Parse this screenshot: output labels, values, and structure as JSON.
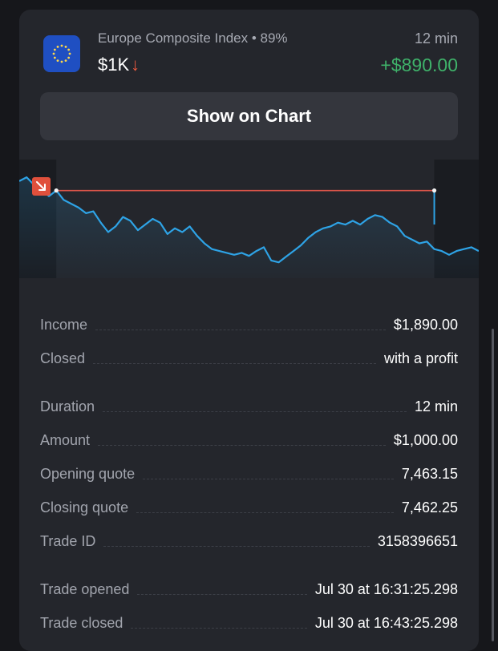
{
  "trade": {
    "asset_name": "Europe Composite Index",
    "separator": " • ",
    "payout_pct": "89%",
    "duration_short": "12 min",
    "amount": "$1K",
    "direction_icon": "arrow-down-icon",
    "direction_glyph": "↓",
    "profit": "+$890.00"
  },
  "buttons": {
    "show_on_chart": "Show on Chart"
  },
  "details": {
    "income": {
      "label": "Income",
      "value": "$1,890.00"
    },
    "closed": {
      "label": "Closed",
      "value": "with a profit"
    },
    "duration": {
      "label": "Duration",
      "value": "12 min"
    },
    "amount": {
      "label": "Amount",
      "value": "$1,000.00"
    },
    "opening_quote": {
      "label": "Opening quote",
      "value": "7,463.15"
    },
    "closing_quote": {
      "label": "Closing quote",
      "value": "7,462.25"
    },
    "trade_id": {
      "label": "Trade ID",
      "value": "3158396651"
    },
    "trade_opened": {
      "label": "Trade opened",
      "value": "Jul 30 at 16:31:25.298"
    },
    "trade_closed": {
      "label": "Trade closed",
      "value": "Jul 30 at 16:43:25.298"
    }
  },
  "colors": {
    "price_line": "#2ea3e6",
    "level_line": "#e0564a",
    "profit": "#3fb26a",
    "down_arrow": "#ef5a3f",
    "flag_blue": "#1f4fc2"
  },
  "chart_data": {
    "type": "line",
    "series": [
      {
        "values": [
          7463.4,
          7463.5,
          7463.3,
          7463.2,
          7463.0,
          7463.15,
          7462.9,
          7462.8,
          7462.7,
          7462.55,
          7462.6,
          7462.3,
          7462.05,
          7462.2,
          7462.45,
          7462.35,
          7462.1,
          7462.25,
          7462.4,
          7462.3,
          7462.0,
          7462.15,
          7462.05,
          7462.2,
          7461.95,
          7461.75,
          7461.6,
          7461.55,
          7461.5,
          7461.45,
          7461.5,
          7461.42,
          7461.55,
          7461.65,
          7461.3,
          7461.25,
          7461.4,
          7461.55,
          7461.7,
          7461.9,
          7462.05,
          7462.15,
          7462.2,
          7462.3,
          7462.25,
          7462.35,
          7462.25,
          7462.4,
          7462.5,
          7462.45,
          7462.3,
          7462.2,
          7461.95,
          7461.85,
          7461.75,
          7461.8,
          7461.6,
          7461.55,
          7461.45,
          7461.55,
          7461.6,
          7461.65,
          7461.55
        ]
      }
    ],
    "opening_quote": 7463.15,
    "closing_quote": 7462.25,
    "direction": "down"
  }
}
